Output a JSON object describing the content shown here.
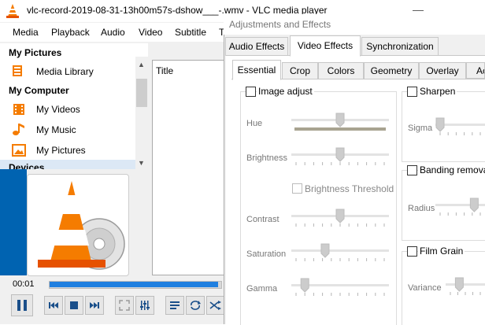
{
  "vlc": {
    "title": "vlc-record-2019-08-31-13h00m57s-dshow___-.wmv - VLC media player",
    "menu": [
      "Media",
      "Playback",
      "Audio",
      "Video",
      "Subtitle",
      "T"
    ],
    "sidebar": {
      "sections": [
        {
          "heading": "My Pictures",
          "items": [
            "Media Library"
          ]
        },
        {
          "heading": "My Computer",
          "items": [
            "My Videos",
            "My Music",
            "My Pictures"
          ]
        },
        {
          "heading": "Devices",
          "items": []
        }
      ]
    },
    "playlist": {
      "column_title": "Title"
    },
    "time_elapsed": "00:01",
    "progress_fraction": 0.98,
    "colors": {
      "accent": "#1f7fe0",
      "cone_orange": "#f57c00"
    }
  },
  "dialog": {
    "title": "Adjustments and Effects",
    "tabs": [
      "Audio Effects",
      "Video Effects",
      "Synchronization"
    ],
    "active_tab": "Video Effects",
    "subtabs": [
      "Essential",
      "Crop",
      "Colors",
      "Geometry",
      "Overlay",
      "Ac"
    ],
    "active_subtab": "Essential",
    "image_adjust": {
      "label": "Image adjust",
      "sliders": [
        {
          "name": "Hue",
          "value": 0.5
        },
        {
          "name": "Brightness",
          "value": 0.5
        },
        {
          "name": "Contrast",
          "value": 0.5
        },
        {
          "name": "Saturation",
          "value": 0.33
        },
        {
          "name": "Gamma",
          "value": 0.1
        }
      ],
      "brightness_threshold": "Brightness Threshold"
    },
    "sharpen": {
      "label": "Sharpen",
      "slider": "Sigma",
      "value": 0.0
    },
    "banding_removal": {
      "label": "Banding removal",
      "slider": "Radius",
      "value": 0.85
    },
    "film_grain": {
      "label": "Film Grain",
      "slider": "Variance",
      "value": 0.3
    }
  }
}
